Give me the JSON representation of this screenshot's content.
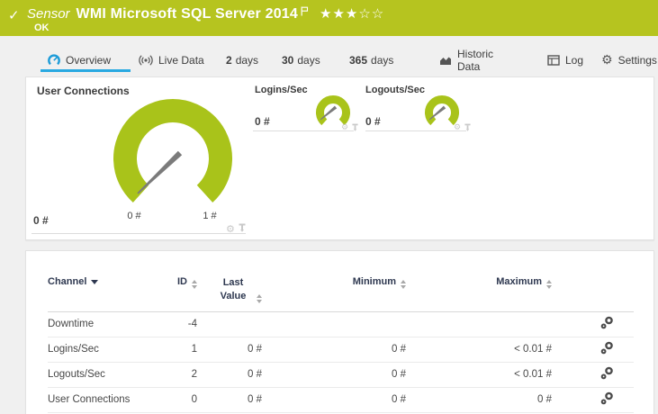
{
  "colors": {
    "brand_green": "#b6c41f",
    "gauge_green": "#a9c31a",
    "active_tab_blue": "#29a9e1"
  },
  "icons": {
    "check": "✓",
    "gear": "⚙"
  },
  "header": {
    "kind": "Sensor",
    "title": "WMI Microsoft SQL Server 2014",
    "rating": "★★★☆☆",
    "status": "OK"
  },
  "tabs": {
    "overview": "Overview",
    "live": "Live Data",
    "d2": {
      "num": "2",
      "unit": "days"
    },
    "d30": {
      "num": "30",
      "unit": "days"
    },
    "d365": {
      "num": "365",
      "unit": "days"
    },
    "historic": "Historic Data",
    "log": "Log",
    "settings": "Settings"
  },
  "gauges": {
    "user_connections": {
      "title": "User Connections",
      "current": "0 #",
      "tick_min": "0 #",
      "tick_max": "1 #"
    },
    "logins": {
      "title": "Logins/Sec",
      "current": "0 #"
    },
    "logouts": {
      "title": "Logouts/Sec",
      "current": "0 #"
    }
  },
  "table": {
    "headers": {
      "channel": "Channel",
      "id": "ID",
      "last_value": "Last Value",
      "minimum": "Minimum",
      "maximum": "Maximum"
    },
    "rows": [
      {
        "channel": "Downtime",
        "id": "-4",
        "last_value": "",
        "minimum": "",
        "maximum": ""
      },
      {
        "channel": "Logins/Sec",
        "id": "1",
        "last_value": "0 #",
        "minimum": "0 #",
        "maximum": "< 0.01 #"
      },
      {
        "channel": "Logouts/Sec",
        "id": "2",
        "last_value": "0 #",
        "minimum": "0 #",
        "maximum": "< 0.01 #"
      },
      {
        "channel": "User Connections",
        "id": "0",
        "last_value": "0 #",
        "minimum": "0 #",
        "maximum": "0 #"
      }
    ]
  }
}
